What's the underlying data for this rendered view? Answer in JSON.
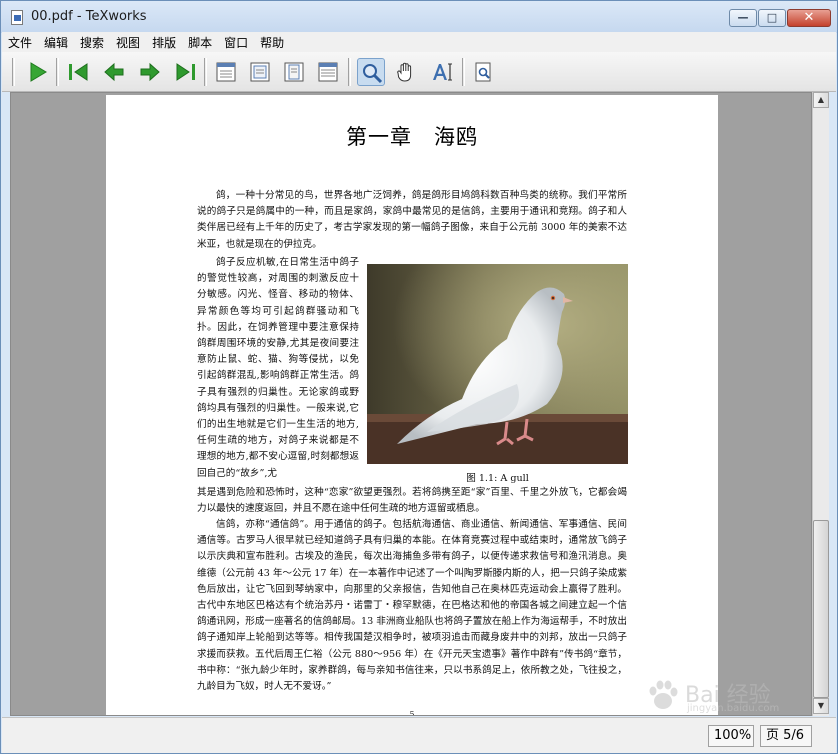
{
  "window": {
    "title": "00.pdf - TeXworks",
    "controls": {
      "minimize": "—",
      "maximize": "□",
      "close": "✕"
    }
  },
  "menu": [
    "文件",
    "编辑",
    "搜索",
    "视图",
    "排版",
    "脚本",
    "窗口",
    "帮助"
  ],
  "toolbar": {
    "buttons": [
      {
        "name": "typeset",
        "icon": "play-icon"
      },
      {
        "name": "first-page",
        "icon": "first-page-icon"
      },
      {
        "name": "previous-page",
        "icon": "arrow-left-icon"
      },
      {
        "name": "next-page",
        "icon": "arrow-right-icon"
      },
      {
        "name": "last-page",
        "icon": "last-page-icon"
      },
      {
        "name": "actual-size",
        "icon": "page-actual-size-icon"
      },
      {
        "name": "fit-width",
        "icon": "page-fit-width-icon"
      },
      {
        "name": "fit-page",
        "icon": "page-fit-page-icon"
      },
      {
        "name": "fit-window",
        "icon": "page-fit-window-icon"
      },
      {
        "name": "magnify-tool",
        "icon": "magnifier-icon",
        "active": true
      },
      {
        "name": "scroll-tool",
        "icon": "hand-icon"
      },
      {
        "name": "select-text-tool",
        "icon": "text-select-icon"
      },
      {
        "name": "find",
        "icon": "find-document-icon"
      }
    ],
    "colors": {
      "play": "#37a634",
      "arrows": "#2f9a2e",
      "magnifier": "#2f5e9e"
    }
  },
  "document": {
    "chapter_title": "第一章　海鸥",
    "paragraph_1": "鸽，一种十分常见的鸟，世界各地广泛饲养，鸽是鸽形目鸠鸽科数百种鸟类的统称。我们平常所说的鸽子只是鸽属中的一种，而且是家鸽，家鸽中最常见的是信鸽，主要用于通讯和竞翔。鸽子和人类伴居已经有上千年的历史了，考古学家发现的第一幅鸽子图像，来自于公元前 3000 年的美索不达米亚，也就是现在的伊拉克。",
    "paragraph_2": "鸽子反应机敏,在日常生活中鸽子的警觉性较高，对周围的刺激反应十分敏感。闪光、怪音、移动的物体、异常颜色等均可引起鸽群骚动和飞扑。因此，在饲养管理中要注意保持鸽群周围环境的安静,尤其是夜间要注意防止鼠、蛇、猫、狗等侵扰，以免引起鸽群混乱,影响鸽群正常生活。鸽子具有强烈的归巢性。无论家鸽或野鸽均具有强烈的归巢性。一般来说,它们的出生地就是它们一生生活的地方,任何生疏的地方，对鸽子来说都是不理想的地方,都不安心逗留,时刻都想返回自己的“故乡”,尤",
    "paragraph_3": "其是遇到危险和恐怖时，这种“恋家”欲望更强烈。若将鸽携至距“家”百里、千里之外放飞，它都会竭力以最快的速度返回，并且不愿在途中任何生疏的地方逗留或栖息。",
    "paragraph_4": "信鸽，亦称“通信鸽”。用于通信的鸽子。包括航海通信、商业通信、新闻通信、军事通信、民间通信等。古罗马人很早就已经知道鸽子具有归巢的本能。在体育竞赛过程中或结束时，通常放飞鸽子以示庆典和宣布胜利。古埃及的渔民，每次出海捕鱼多带有鸽子，以便传递求救信号和渔汛消息。奥维德（公元前 43 年～公元 17 年）在一本著作中记述了一个叫陶罗斯滕内斯的人，把一只鸽子染成紫色后放出，让它飞回到琴纳家中，向那里的父亲报信，告知他自己在奥林匹克运动会上赢得了胜利。古代中东地区巴格达有个统治苏丹・诺雷丁・穆罕默德，在巴格达和他的帝国各城之间建立起一个信鸽通讯网，形成一座著名的信鸽邮局。13 非洲商业船队也将鸽子置放在船上作为海运帮手，不时放出鸽子通知岸上轮船到达等等。相传我国楚汉相争时，被项羽追击而藏身废井中的刘邦，放出一只鸽子求援而获救。五代后周王仁裕（公元 880～956 年）在《开元天宝遗事》著作中辟有”传书鸽“章节，书中称：“张九龄少年时，家养群鸽，每与亲知书信往来，只以书系鸽足上，依所教之处，飞往投之，九龄目为飞奴，时人无不爱讶。”",
    "figure_caption": "图 1.1: A gull",
    "page_number": "5"
  },
  "statusbar": {
    "zoom": "100%",
    "page_position": "页 5/6"
  },
  "watermark": {
    "brand": "Bai  经验",
    "url": "jingyan.baidu.com"
  }
}
